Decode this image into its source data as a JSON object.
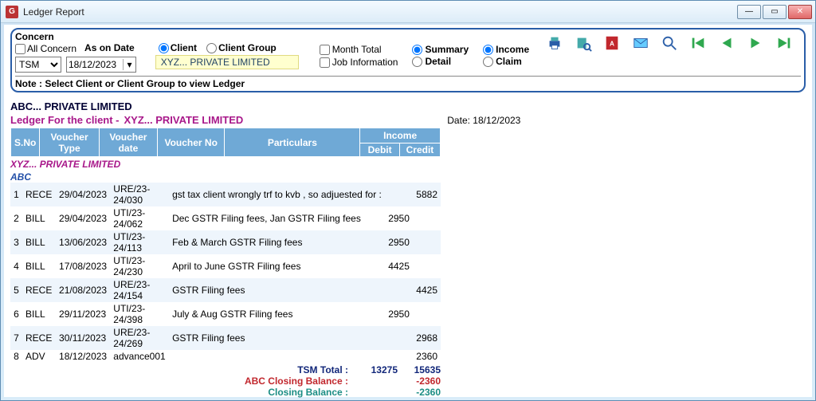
{
  "window": {
    "title": "Ledger Report"
  },
  "filters": {
    "concern_label": "Concern",
    "all_concern_label": "All Concern",
    "as_on_date_label": "As on Date",
    "concern_value": "TSM",
    "date_value": "18/12/2023",
    "client_label": "Client",
    "client_group_label": "Client Group",
    "client_mode": "client",
    "client_name": "XYZ... PRIVATE LIMITED",
    "month_total_label": "Month Total",
    "job_info_label": "Job Information",
    "summary_label": "Summary",
    "detail_label": "Detail",
    "summary_mode": "summary",
    "income_label": "Income",
    "claim_label": "Claim",
    "income_mode": "income",
    "note": "Note : Select Client or Client Group to view Ledger"
  },
  "toolbar_icons": [
    "print",
    "preview",
    "pdf",
    "email",
    "zoom",
    "first",
    "prev",
    "next",
    "last"
  ],
  "report": {
    "heading": "ABC... PRIVATE LIMITED",
    "ledger_prefix": "Ledger For the client -",
    "ledger_client": "XYZ... PRIVATE LIMITED",
    "date_label": "Date:",
    "date_value": "18/12/2023",
    "group1": "XYZ... PRIVATE LIMITED",
    "group2": "ABC",
    "columns": {
      "sno": "S.No",
      "vtype": "Voucher Type",
      "vdate": "Voucher date",
      "vno": "Voucher No",
      "part": "Particulars",
      "income": "Income",
      "debit": "Debit",
      "credit": "Credit"
    },
    "rows": [
      {
        "sno": "1",
        "type": "RECE",
        "date": "29/04/2023",
        "vno": "URE/23-24/030",
        "part": "gst tax  client wrongly trf to kvb , so adjuested for :",
        "debit": "",
        "credit": "5882"
      },
      {
        "sno": "2",
        "type": "BILL",
        "date": "29/04/2023",
        "vno": "UTI/23-24/062",
        "part": "Dec GSTR Filing fees,  Jan GSTR Filing fees",
        "debit": "2950",
        "credit": ""
      },
      {
        "sno": "3",
        "type": "BILL",
        "date": "13/06/2023",
        "vno": "UTI/23-24/113",
        "part": "Feb &  March GSTR Filing fees",
        "debit": "2950",
        "credit": ""
      },
      {
        "sno": "4",
        "type": "BILL",
        "date": "17/08/2023",
        "vno": "UTI/23-24/230",
        "part": "April to June GSTR Filing fees",
        "debit": "4425",
        "credit": ""
      },
      {
        "sno": "5",
        "type": "RECE",
        "date": "21/08/2023",
        "vno": "URE/23-24/154",
        "part": "GSTR Filing fees",
        "debit": "",
        "credit": "4425"
      },
      {
        "sno": "6",
        "type": "BILL",
        "date": "29/11/2023",
        "vno": "UTI/23-24/398",
        "part": "July & Aug GSTR Filing fees",
        "debit": "2950",
        "credit": ""
      },
      {
        "sno": "7",
        "type": "RECE",
        "date": "30/11/2023",
        "vno": "URE/23-24/269",
        "part": "GSTR Filing fees",
        "debit": "",
        "credit": "2968"
      },
      {
        "sno": "8",
        "type": "ADV",
        "date": "18/12/2023",
        "vno": "advance001",
        "part": "",
        "debit": "",
        "credit": "2360"
      }
    ],
    "tsm_total_label": "TSM Total :",
    "tsm_debit": "13275",
    "tsm_credit": "15635",
    "abc_closing_label": "ABC Closing Balance :",
    "abc_closing": "-2360",
    "closing_label": "Closing  Balance :",
    "closing": "-2360"
  }
}
